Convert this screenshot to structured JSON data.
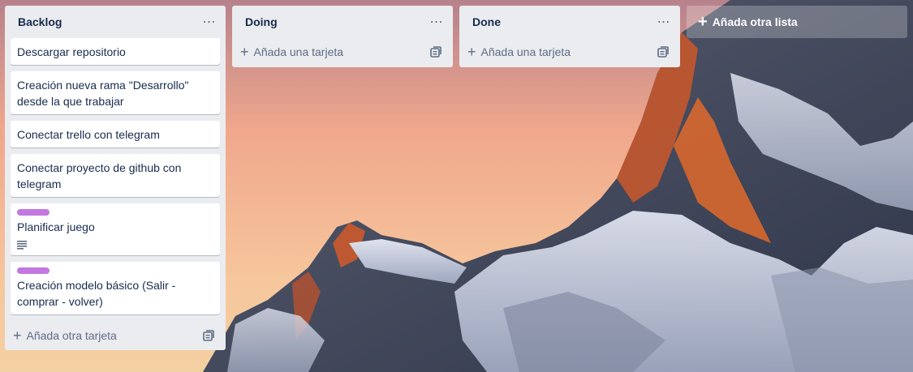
{
  "board": {
    "lists": [
      {
        "title": "Backlog",
        "cards": [
          {
            "text": "Descargar repositorio"
          },
          {
            "text": "Creación nueva rama \"Desarrollo\" desde la que trabajar"
          },
          {
            "text": "Conectar trello con telegram"
          },
          {
            "text": "Conectar proyecto de github con telegram"
          },
          {
            "text": "Planificar juego",
            "label_color": "#c377e0",
            "has_description": true
          },
          {
            "text": "Creación modelo básico (Salir - comprar - volver)",
            "label_color": "#c377e0"
          }
        ],
        "add_card_label": "Añada otra tarjeta"
      },
      {
        "title": "Doing",
        "cards": [],
        "add_card_label": "Añada una tarjeta"
      },
      {
        "title": "Done",
        "cards": [],
        "add_card_label": "Añada una tarjeta"
      }
    ],
    "add_list_label": "Añada otra lista"
  },
  "icons": {
    "list_menu": "ellipsis-icon",
    "add": "plus-icon",
    "template": "card-template-icon",
    "description": "description-icon"
  }
}
